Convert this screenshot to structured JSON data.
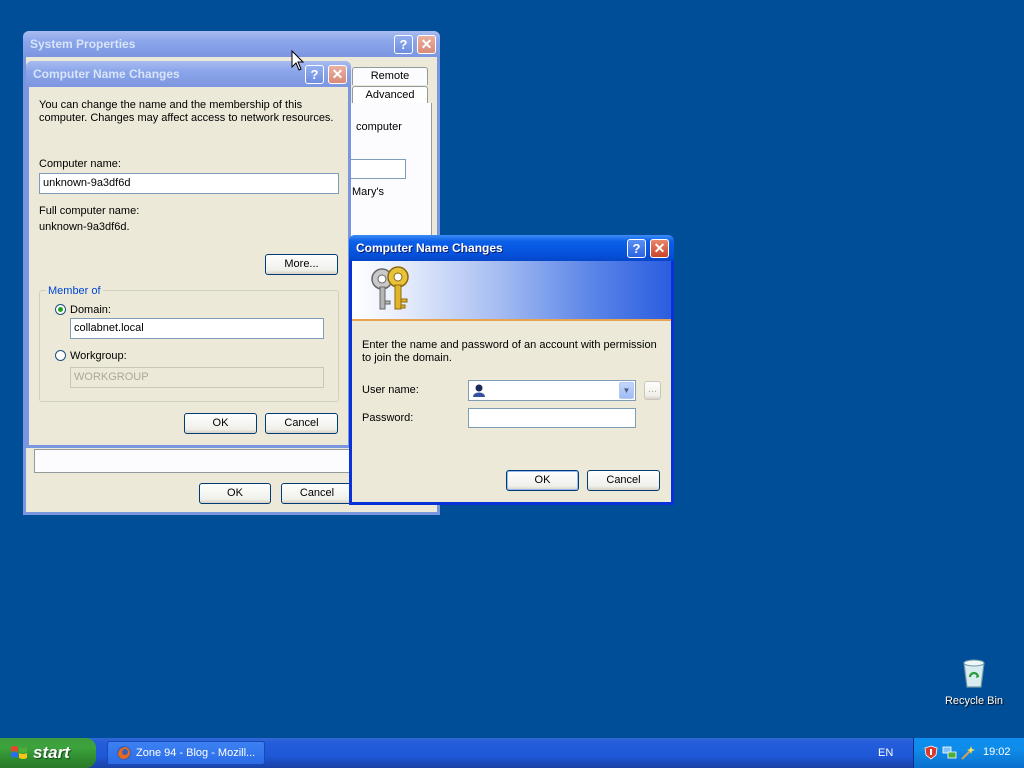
{
  "sysprops": {
    "title": "System Properties",
    "tabs": [
      "Remote",
      "Advanced"
    ],
    "partial_text_1": "computer",
    "partial_text_2": "Mary's",
    "ok_label": "OK",
    "cancel_label": "Cancel"
  },
  "cnc1": {
    "title": "Computer Name Changes",
    "intro": [
      "You can change the name and the membership of this",
      "computer. Changes may affect access to network resources."
    ],
    "computer_name_label": "Computer name:",
    "computer_name_value": "unknown-9a3df6d",
    "full_name_label": "Full computer name:",
    "full_name_value": "unknown-9a3df6d.",
    "more_label": "More...",
    "member_of_label": "Member of",
    "domain_label": "Domain:",
    "domain_value": "collabnet.local",
    "domain_selected": true,
    "workgroup_label": "Workgroup:",
    "workgroup_value": "WORKGROUP",
    "ok_label": "OK",
    "cancel_label": "Cancel"
  },
  "cnc2": {
    "title": "Computer Name Changes",
    "intro": [
      "Enter the name and password of an account with permission",
      "to join the domain."
    ],
    "username_label": "User name:",
    "username_value": "",
    "browse_label": "...",
    "password_label": "Password:",
    "password_value": "",
    "ok_label": "OK",
    "cancel_label": "Cancel"
  },
  "desktop": {
    "recycle_bin_label": "Recycle Bin"
  },
  "taskbar": {
    "start_label": "start",
    "task_label": "Zone 94 - Blog - Mozill...",
    "language": "EN",
    "clock": "19:02"
  },
  "colors": {
    "desktop": "#004e98",
    "active_title": "#0653de",
    "inactive_title": "#7c97e0",
    "dialog_face": "#ece9d8",
    "start_green": "#3da33d"
  },
  "icons": [
    "help-icon",
    "close-icon",
    "keys-icon",
    "user-icon",
    "dropdown-icon",
    "recycle-bin-icon",
    "firefox-icon",
    "windows-logo-icon",
    "security-shield-icon",
    "network-icon",
    "wand-icon",
    "cursor-icon"
  ]
}
